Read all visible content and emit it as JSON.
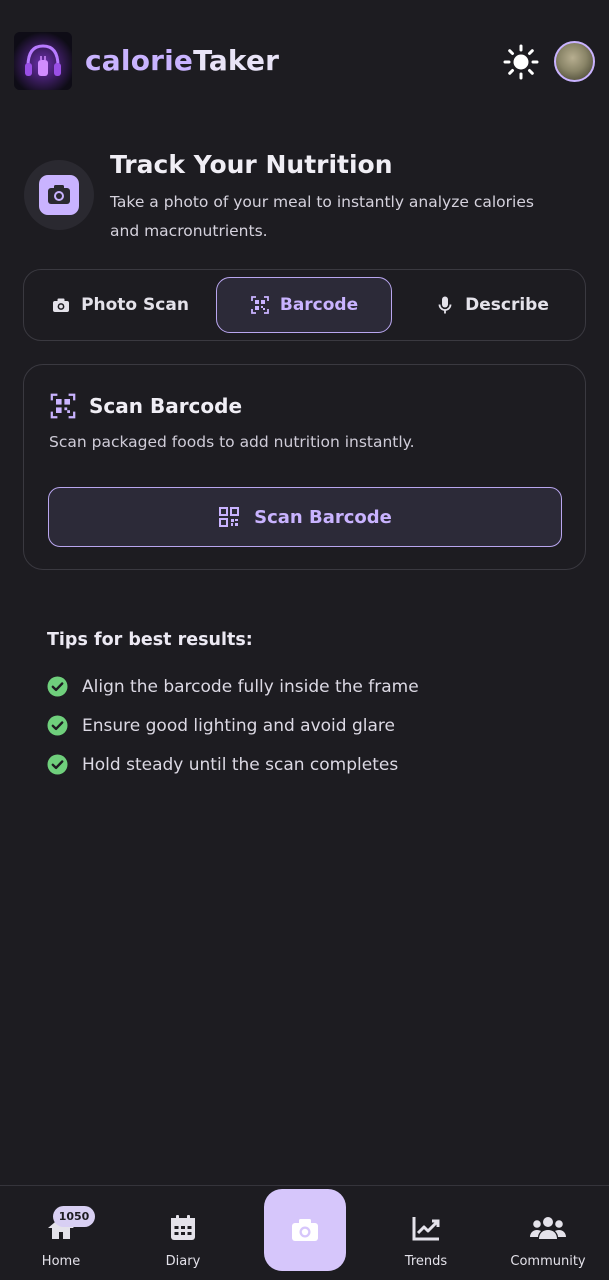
{
  "header": {
    "title_part1": "calorie",
    "title_part2": "Taker",
    "logo_icon": "headphones-logo-icon",
    "theme_toggle_icon": "sun-icon",
    "avatar_icon": "user-avatar"
  },
  "hero": {
    "icon": "camera-icon",
    "title": "Track Your Nutrition",
    "subtitle": "Take a photo of your meal to instantly analyze calories and macronutrients."
  },
  "tabs": [
    {
      "label": "Photo Scan",
      "icon": "camera-icon",
      "active": false
    },
    {
      "label": "Barcode",
      "icon": "barcode-scan-icon",
      "active": true
    },
    {
      "label": "Describe",
      "icon": "microphone-icon",
      "active": false
    }
  ],
  "scan_card": {
    "icon": "barcode-scan-icon",
    "title": "Scan Barcode",
    "subtitle": "Scan packaged foods to add nutrition instantly.",
    "button_label": "Scan Barcode",
    "button_icon": "qr-code-icon"
  },
  "tips": {
    "title": "Tips for best results:",
    "items": [
      "Align the barcode fully inside the frame",
      "Ensure good lighting and avoid glare",
      "Hold steady until the scan completes"
    ]
  },
  "bottom_nav": {
    "items": [
      {
        "label": "Home",
        "icon": "home-icon",
        "badge": "1050"
      },
      {
        "label": "Diary",
        "icon": "calendar-icon"
      },
      {
        "label": "",
        "icon": "camera-icon"
      },
      {
        "label": "Trends",
        "icon": "chart-trend-icon"
      },
      {
        "label": "Community",
        "icon": "users-icon"
      }
    ]
  },
  "colors": {
    "background": "#1d1c21",
    "accent": "#c9b3ff",
    "success": "#6fcf7c"
  }
}
